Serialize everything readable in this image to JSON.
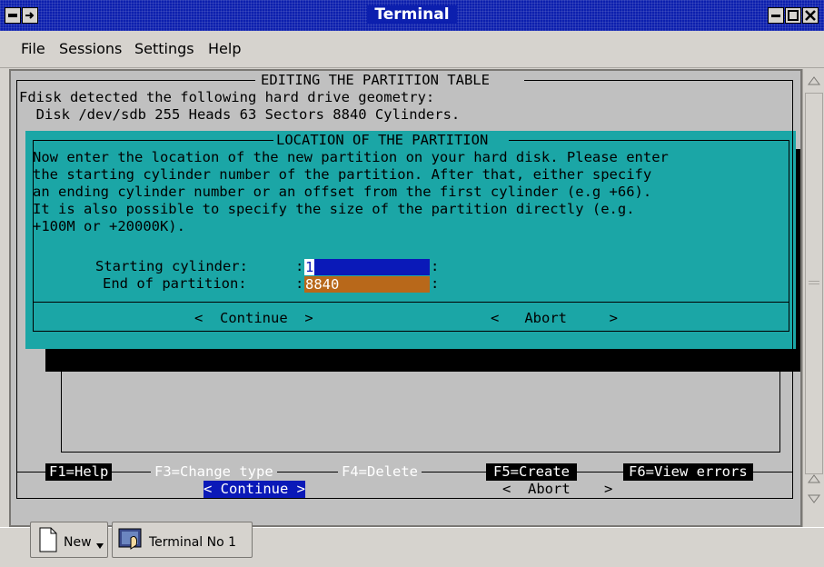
{
  "window": {
    "title": "Terminal"
  },
  "menu": [
    "File",
    "Sessions",
    "Settings",
    "Help"
  ],
  "outer_box": {
    "title": "EDITING THE PARTITION TABLE",
    "line1": "Fdisk detected the following hard drive geometry:",
    "line2": "  Disk /dev/sdb 255 Heads 63 Sectors 8840 Cylinders."
  },
  "dialog": {
    "title": "LOCATION OF THE PARTITION",
    "body": [
      "Now enter the location of the new partition on your hard disk. Please enter",
      "the starting cylinder number of the partition. After that, either specify",
      "an ending cylinder number or an offset from the first cylinder (e.g +66).",
      "It is also possible to specify the size of the partition directly (e.g.",
      "+100M or +20000K)."
    ],
    "starting_label": "Starting cylinder:",
    "starting_value": "1",
    "end_label": "End of partition:",
    "end_value": "8840",
    "continue_label": "Continue",
    "abort_label": "Abort"
  },
  "function_keys": {
    "f1": "F1=Help",
    "f3": "F3=Change type",
    "f4": "F4=Delete",
    "f5": "F5=Create",
    "f6": "F6=View errors"
  },
  "bottom_buttons": {
    "continue": "< Continue >",
    "abort": "<  Abort    >"
  },
  "taskbar": {
    "new_label": "New",
    "terminal_label": "Terminal No 1"
  },
  "colors": {
    "dialog_bg": "#1ba6a6",
    "field_focused": "#0a19b8",
    "field_normal": "#b8681a",
    "title_bar": "#0c1fae"
  }
}
